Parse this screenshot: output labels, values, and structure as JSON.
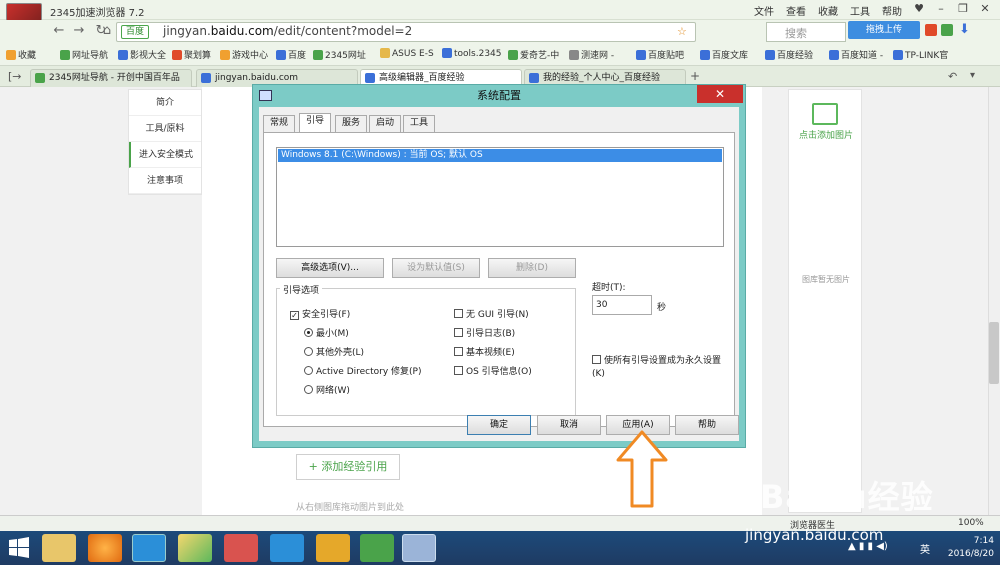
{
  "browser": {
    "title": "2345加速浏览器 7.2",
    "menus": [
      "文件",
      "查看",
      "收藏",
      "工具",
      "帮助"
    ],
    "address": {
      "security_label": "百度",
      "url_prefix": "jingyan.",
      "url_host": "baidu.com",
      "url_path": "/edit/content?model=2"
    },
    "search_placeholder": "搜索",
    "drag_upload": "拖拽上传"
  },
  "bookmarks": [
    {
      "label": "收藏",
      "color": "#f0a030"
    },
    {
      "label": "网址导航",
      "color": "#4aa34a"
    },
    {
      "label": "影视大全",
      "color": "#3b6fd8"
    },
    {
      "label": "聚划算",
      "color": "#e04a2a"
    },
    {
      "label": "游戏中心",
      "color": "#f0a030"
    },
    {
      "label": "百度",
      "color": "#3b6fd8"
    },
    {
      "label": "2345网址",
      "color": "#4aa34a"
    },
    {
      "label": "ASUS E-S",
      "color": "#e5b84a"
    },
    {
      "label": "tools.2345",
      "color": "#3b6fd8"
    },
    {
      "label": "爱奇艺-中",
      "color": "#4aa34a"
    },
    {
      "label": "测速网 -",
      "color": "#888"
    },
    {
      "label": "百度贴吧",
      "color": "#3b6fd8"
    },
    {
      "label": "百度文库",
      "color": "#3b6fd8"
    },
    {
      "label": "百度经验",
      "color": "#3b6fd8"
    },
    {
      "label": "百度知道 -",
      "color": "#3b6fd8"
    },
    {
      "label": "TP-LINK官",
      "color": "#3b6fd8"
    }
  ],
  "tabs": [
    {
      "label": "2345网址导航 - 开创中国百年品"
    },
    {
      "label": "jingyan.baidu.com"
    },
    {
      "label": "高级编辑器_百度经验"
    },
    {
      "label": "我的经验_个人中心_百度经验"
    }
  ],
  "new_tab": "+",
  "page": {
    "left_nav": [
      "简介",
      "工具/原料",
      "进入安全模式",
      "注意事项"
    ],
    "add_image": "点击添加图片",
    "no_image": "图库暂无图片",
    "add_ref": "+ 添加经验引用",
    "drag_hint": "从右侧图库拖动图片到此处"
  },
  "dialog": {
    "title": "系统配置",
    "close": "✕",
    "tabs": [
      "常规",
      "引导",
      "服务",
      "启动",
      "工具"
    ],
    "os_entry": "Windows 8.1 (C:\\Windows) : 当前 OS; 默认 OS",
    "advanced": "高级选项(V)...",
    "set_default": "设为默认值(S)",
    "delete": "删除(D)",
    "boot_options": "引导选项",
    "safe_boot": "安全引导(F)",
    "minimal": "最小(M)",
    "alt_shell": "其他外壳(L)",
    "ad_repair": "Active Directory 修复(P)",
    "network": "网络(W)",
    "no_gui": "无 GUI 引导(N)",
    "boot_log": "引导日志(B)",
    "base_video": "基本视频(E)",
    "os_info": "OS 引导信息(O)",
    "timeout_label": "超时(T):",
    "timeout_value": "30",
    "timeout_unit": "秒",
    "permanent": "使所有引导设置成为永久设置(K)",
    "ok": "确定",
    "cancel": "取消",
    "apply": "应用(A)",
    "help": "帮助"
  },
  "statusbar": {
    "doctor": "浏览器医生",
    "zoom": "100%"
  },
  "watermark": {
    "brand": "Baidu经验",
    "url": "jingyan.baidu.com"
  },
  "clock": {
    "time": "7:14",
    "date": "2016/8/20",
    "ime": "英"
  }
}
